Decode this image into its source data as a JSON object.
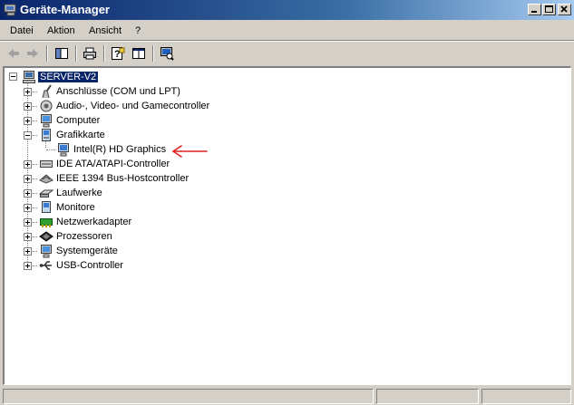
{
  "window": {
    "title": "Geräte-Manager",
    "icon": "device-manager-icon"
  },
  "menu": {
    "items": [
      {
        "label": "Datei"
      },
      {
        "label": "Aktion"
      },
      {
        "label": "Ansicht"
      },
      {
        "label": "?"
      }
    ]
  },
  "toolbar": {
    "buttons": [
      {
        "icon": "back-arrow-icon"
      },
      {
        "icon": "forward-arrow-icon"
      },
      {
        "icon": "console-tree-icon"
      },
      {
        "icon": "print-icon"
      },
      {
        "icon": "help-properties-icon"
      },
      {
        "icon": "view-pane-icon"
      },
      {
        "icon": "scan-hardware-icon"
      }
    ]
  },
  "tree": {
    "root": {
      "label": "SERVER-V2",
      "icon": "computer-icon",
      "expanded": true,
      "selected": true
    },
    "categories": [
      {
        "label": "Anschlüsse (COM und LPT)",
        "icon": "port-icon",
        "expanded": false
      },
      {
        "label": "Audio-, Video- und Gamecontroller",
        "icon": "audio-icon",
        "expanded": false
      },
      {
        "label": "Computer",
        "icon": "computer-icon",
        "expanded": false
      },
      {
        "label": "Grafikkarte",
        "icon": "display-adapter-icon",
        "expanded": true,
        "children": [
          {
            "label": "Intel(R) HD Graphics",
            "icon": "display-adapter-icon"
          }
        ]
      },
      {
        "label": "IDE ATA/ATAPI-Controller",
        "icon": "ide-controller-icon",
        "expanded": false
      },
      {
        "label": "IEEE 1394 Bus-Hostcontroller",
        "icon": "firewire-icon",
        "expanded": false
      },
      {
        "label": "Laufwerke",
        "icon": "disk-drive-icon",
        "expanded": false
      },
      {
        "label": "Monitore",
        "icon": "monitor-icon",
        "expanded": false
      },
      {
        "label": "Netzwerkadapter",
        "icon": "network-adapter-icon",
        "expanded": false
      },
      {
        "label": "Prozessoren",
        "icon": "processor-icon",
        "expanded": false
      },
      {
        "label": "Systemgeräte",
        "icon": "system-devices-icon",
        "expanded": false
      },
      {
        "label": "USB-Controller",
        "icon": "usb-icon",
        "expanded": false
      }
    ]
  },
  "annotation": {
    "type": "arrow",
    "color": "#e02020",
    "points_to": "Intel(R) HD Graphics"
  },
  "colors": {
    "title_gradient_start": "#0a246a",
    "title_gradient_end": "#a6caf0",
    "selection": "#0a246a",
    "chrome": "#d4d0c8"
  },
  "statusbar": {
    "cells": [
      "",
      "",
      ""
    ]
  }
}
